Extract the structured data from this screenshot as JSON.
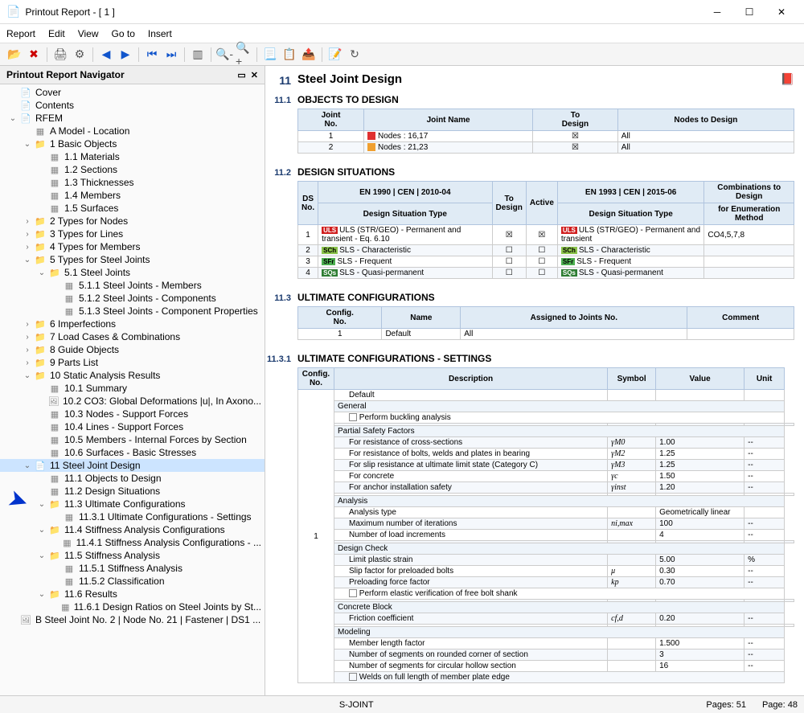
{
  "window": {
    "title": "Printout Report - [ 1 ]"
  },
  "menu": [
    "Report",
    "Edit",
    "View",
    "Go to",
    "Insert"
  ],
  "nav": {
    "title": "Printout Report Navigator",
    "items": [
      {
        "d": 0,
        "t": null,
        "i": "doc",
        "l": "Cover"
      },
      {
        "d": 0,
        "t": null,
        "i": "doc",
        "l": "Contents"
      },
      {
        "d": 0,
        "t": "open",
        "i": "doc",
        "l": "RFEM"
      },
      {
        "d": 1,
        "t": null,
        "i": "grid",
        "l": "A Model - Location"
      },
      {
        "d": 1,
        "t": "open",
        "i": "folder",
        "l": "1 Basic Objects"
      },
      {
        "d": 2,
        "t": null,
        "i": "grid",
        "l": "1.1 Materials"
      },
      {
        "d": 2,
        "t": null,
        "i": "grid",
        "l": "1.2 Sections"
      },
      {
        "d": 2,
        "t": null,
        "i": "grid",
        "l": "1.3 Thicknesses"
      },
      {
        "d": 2,
        "t": null,
        "i": "grid",
        "l": "1.4 Members"
      },
      {
        "d": 2,
        "t": null,
        "i": "grid",
        "l": "1.5 Surfaces"
      },
      {
        "d": 1,
        "t": "closed",
        "i": "folder",
        "l": "2 Types for Nodes"
      },
      {
        "d": 1,
        "t": "closed",
        "i": "folder",
        "l": "3 Types for Lines"
      },
      {
        "d": 1,
        "t": "closed",
        "i": "folder",
        "l": "4 Types for Members"
      },
      {
        "d": 1,
        "t": "open",
        "i": "folder",
        "l": "5 Types for Steel Joints"
      },
      {
        "d": 2,
        "t": "open",
        "i": "folder",
        "l": "5.1 Steel Joints"
      },
      {
        "d": 3,
        "t": null,
        "i": "grid",
        "l": "5.1.1 Steel Joints - Members"
      },
      {
        "d": 3,
        "t": null,
        "i": "grid",
        "l": "5.1.2 Steel Joints - Components"
      },
      {
        "d": 3,
        "t": null,
        "i": "grid",
        "l": "5.1.3 Steel Joints - Component Properties"
      },
      {
        "d": 1,
        "t": "closed",
        "i": "folder",
        "l": "6 Imperfections"
      },
      {
        "d": 1,
        "t": "closed",
        "i": "folder",
        "l": "7 Load Cases & Combinations"
      },
      {
        "d": 1,
        "t": "closed",
        "i": "folder",
        "l": "8 Guide Objects"
      },
      {
        "d": 1,
        "t": "closed",
        "i": "folder",
        "l": "9 Parts List"
      },
      {
        "d": 1,
        "t": "open",
        "i": "folder",
        "l": "10 Static Analysis Results"
      },
      {
        "d": 2,
        "t": null,
        "i": "grid",
        "l": "10.1 Summary"
      },
      {
        "d": 2,
        "t": null,
        "i": "img",
        "l": "10.2 CO3: Global Deformations |u|, In Axono..."
      },
      {
        "d": 2,
        "t": null,
        "i": "grid",
        "l": "10.3 Nodes - Support Forces"
      },
      {
        "d": 2,
        "t": null,
        "i": "grid",
        "l": "10.4 Lines - Support Forces"
      },
      {
        "d": 2,
        "t": null,
        "i": "grid",
        "l": "10.5 Members - Internal Forces by Section"
      },
      {
        "d": 2,
        "t": null,
        "i": "grid",
        "l": "10.6 Surfaces - Basic Stresses"
      },
      {
        "d": 1,
        "t": "open",
        "i": "doc",
        "l": "11 Steel Joint Design",
        "sel": true
      },
      {
        "d": 2,
        "t": null,
        "i": "grid",
        "l": "11.1 Objects to Design"
      },
      {
        "d": 2,
        "t": null,
        "i": "grid",
        "l": "11.2 Design Situations"
      },
      {
        "d": 2,
        "t": "open",
        "i": "folder",
        "l": "11.3 Ultimate Configurations"
      },
      {
        "d": 3,
        "t": null,
        "i": "grid",
        "l": "11.3.1 Ultimate Configurations - Settings"
      },
      {
        "d": 2,
        "t": "open",
        "i": "folder",
        "l": "11.4 Stiffness Analysis Configurations"
      },
      {
        "d": 3,
        "t": null,
        "i": "grid",
        "l": "11.4.1 Stiffness Analysis Configurations - ..."
      },
      {
        "d": 2,
        "t": "open",
        "i": "folder",
        "l": "11.5 Stiffness Analysis"
      },
      {
        "d": 3,
        "t": null,
        "i": "grid",
        "l": "11.5.1 Stiffness Analysis"
      },
      {
        "d": 3,
        "t": null,
        "i": "grid",
        "l": "11.5.2 Classification"
      },
      {
        "d": 2,
        "t": "open",
        "i": "folder",
        "l": "11.6 Results"
      },
      {
        "d": 3,
        "t": null,
        "i": "grid",
        "l": "11.6.1 Design Ratios on Steel Joints by St..."
      },
      {
        "d": 0,
        "t": null,
        "i": "img",
        "l": "B Steel Joint No. 2 | Node No. 21 | Fastener | DS1 ..."
      }
    ]
  },
  "content": {
    "h1num": "11",
    "h1": "Steel Joint Design",
    "s11_1": {
      "num": "11.1",
      "title": "OBJECTS TO DESIGN",
      "headers": [
        "Joint\nNo.",
        "Joint Name",
        "To\nDesign",
        "Nodes to Design"
      ],
      "rows": [
        {
          "no": "1",
          "color": "#e03030",
          "name": "Nodes : 16,17",
          "td": "☒",
          "nodes": "All"
        },
        {
          "no": "2",
          "color": "#f0a030",
          "name": "Nodes : 21,23",
          "td": "☒",
          "nodes": "All"
        }
      ]
    },
    "s11_2": {
      "num": "11.2",
      "title": "DESIGN SITUATIONS",
      "h1": "DS\nNo.",
      "h2a": "EN 1990 | CEN | 2010-04",
      "h2b": "Design Situation Type",
      "h3": "To\nDesign",
      "h4": "Active",
      "h5a": "EN 1993 | CEN | 2015-06",
      "h5b": "Design Situation Type",
      "h6a": "Combinations to Design",
      "h6b": "for Enumeration Method",
      "rows": [
        {
          "no": "1",
          "tag": "uls",
          "tagl": "ULS",
          "t1": "ULS (STR/GEO) - Permanent and transient - Eq. 6.10",
          "td": "☒",
          "ac": "☒",
          "tag2": "uls",
          "tagl2": "ULS",
          "t2": "ULS (STR/GEO) - Permanent and transient",
          "comb": "CO4,5,7,8"
        },
        {
          "no": "2",
          "tag": "sch",
          "tagl": "SCh",
          "t1": "SLS - Characteristic",
          "td": "☐",
          "ac": "☐",
          "tag2": "sch",
          "tagl2": "SCh",
          "t2": "SLS - Characteristic",
          "comb": ""
        },
        {
          "no": "3",
          "tag": "sfr",
          "tagl": "SFr",
          "t1": "SLS - Frequent",
          "td": "☐",
          "ac": "☐",
          "tag2": "sfr",
          "tagl2": "SFr",
          "t2": "SLS - Frequent",
          "comb": ""
        },
        {
          "no": "4",
          "tag": "sqs",
          "tagl": "SQs",
          "t1": "SLS - Quasi-permanent",
          "td": "☐",
          "ac": "☐",
          "tag2": "sqs",
          "tagl2": "SQs",
          "t2": "SLS - Quasi-permanent",
          "comb": ""
        }
      ]
    },
    "s11_3": {
      "num": "11.3",
      "title": "ULTIMATE CONFIGURATIONS",
      "headers": [
        "Config.\nNo.",
        "Name",
        "Assigned to Joints No.",
        "Comment"
      ],
      "rows": [
        {
          "no": "1",
          "name": "Default",
          "assigned": "All",
          "comment": ""
        }
      ]
    },
    "s11_3_1": {
      "num": "11.3.1",
      "title": "ULTIMATE CONFIGURATIONS - SETTINGS",
      "headers": [
        "Config.\nNo.",
        "Description",
        "Symbol",
        "Value",
        "Unit"
      ],
      "rows": [
        {
          "no": "1",
          "indent": 1,
          "desc": "Default",
          "sym": "",
          "val": "",
          "unit": ""
        },
        {
          "indent": 0,
          "desc": "General",
          "grp": true
        },
        {
          "indent": 1,
          "cb": true,
          "desc": "Perform buckling analysis"
        },
        {
          "blank": true
        },
        {
          "indent": 0,
          "desc": "Partial Safety Factors",
          "grp": true
        },
        {
          "indent": 1,
          "desc": "For resistance of cross-sections",
          "sym": "γM0",
          "val": "1.00",
          "unit": "--"
        },
        {
          "indent": 1,
          "desc": "For resistance of bolts, welds and plates in bearing",
          "sym": "γM2",
          "val": "1.25",
          "unit": "--"
        },
        {
          "indent": 1,
          "desc": "For slip resistance at ultimate limit state (Category C)",
          "sym": "γM3",
          "val": "1.25",
          "unit": "--"
        },
        {
          "indent": 1,
          "desc": "For concrete",
          "sym": "γc",
          "val": "1.50",
          "unit": "--"
        },
        {
          "indent": 1,
          "desc": "For anchor installation safety",
          "sym": "γinst",
          "val": "1.20",
          "unit": "--"
        },
        {
          "blank": true
        },
        {
          "indent": 0,
          "desc": "Analysis",
          "grp": true
        },
        {
          "indent": 1,
          "desc": "Analysis type",
          "sym": "",
          "val": "Geometrically linear",
          "unit": ""
        },
        {
          "indent": 1,
          "desc": "Maximum number of iterations",
          "sym": "ni,max",
          "val": "100",
          "unit": "--"
        },
        {
          "indent": 1,
          "desc": "Number of load increments",
          "sym": "",
          "val": "4",
          "unit": "--"
        },
        {
          "blank": true
        },
        {
          "indent": 0,
          "desc": "Design Check",
          "grp": true
        },
        {
          "indent": 1,
          "desc": "Limit plastic strain",
          "sym": "",
          "val": "5.00",
          "unit": "%"
        },
        {
          "indent": 1,
          "desc": "Slip factor for preloaded bolts",
          "sym": "μ",
          "val": "0.30",
          "unit": "--"
        },
        {
          "indent": 1,
          "desc": "Preloading force factor",
          "sym": "kp",
          "val": "0.70",
          "unit": "--"
        },
        {
          "indent": 1,
          "cb": true,
          "desc": "Perform elastic verification of free bolt shank"
        },
        {
          "blank": true
        },
        {
          "indent": 0,
          "desc": "Concrete Block",
          "grp": true
        },
        {
          "indent": 1,
          "desc": "Friction coefficient",
          "sym": "cf,d",
          "val": "0.20",
          "unit": "--"
        },
        {
          "blank": true
        },
        {
          "indent": 0,
          "desc": "Modeling",
          "grp": true
        },
        {
          "indent": 1,
          "desc": "Member length factor",
          "sym": "",
          "val": "1.500",
          "unit": "--"
        },
        {
          "indent": 1,
          "desc": "Number of segments on rounded corner of section",
          "sym": "",
          "val": "3",
          "unit": "--"
        },
        {
          "indent": 1,
          "desc": "Number of segments for circular hollow section",
          "sym": "",
          "val": "16",
          "unit": "--"
        },
        {
          "indent": 1,
          "cb": true,
          "desc": "Welds on full length of member plate edge"
        }
      ]
    }
  },
  "status": {
    "center": "S-JOINT",
    "pages": "Pages: 51",
    "page": "Page: 48"
  }
}
